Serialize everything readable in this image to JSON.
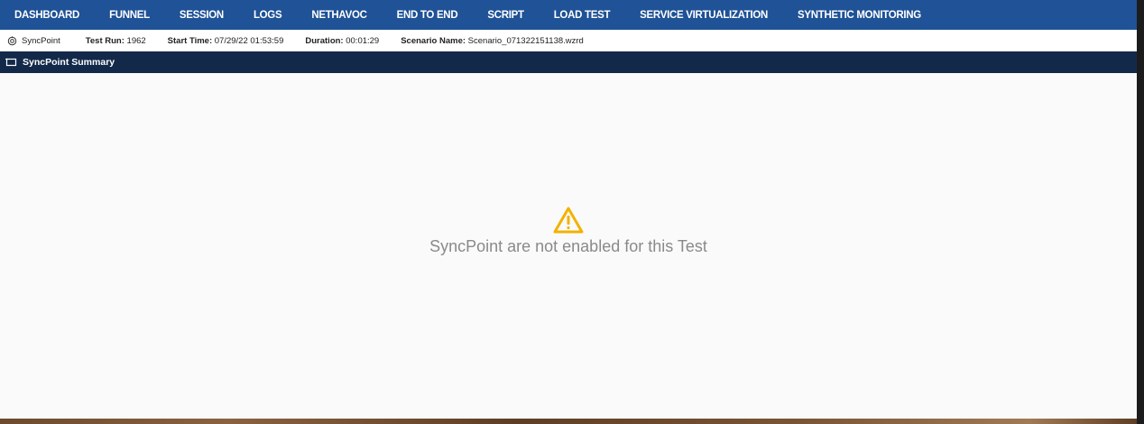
{
  "nav": {
    "items": [
      "DASHBOARD",
      "FUNNEL",
      "SESSION",
      "LOGS",
      "NETHAVOC",
      "END TO END",
      "SCRIPT",
      "LOAD TEST",
      "SERVICE VIRTUALIZATION",
      "SYNTHETIC MONITORING"
    ]
  },
  "info": {
    "section": "SyncPoint",
    "test_run_label": "Test Run:",
    "test_run": "1962",
    "start_time_label": "Start Time:",
    "start_time": "07/29/22 01:53:59",
    "duration_label": "Duration:",
    "duration": "00:01:29",
    "scenario_label": "Scenario Name:",
    "scenario": "Scenario_071322151138.wzrd"
  },
  "panel": {
    "title": "SyncPoint Summary",
    "icon": "panel-icon"
  },
  "empty": {
    "icon": "warning-icon",
    "message": "SyncPoint are not enabled for this Test"
  },
  "colors": {
    "nav_bg": "#1f5296",
    "panel_header_bg": "#13294a",
    "warning": "#f2b200",
    "message_text": "#8a8a8a"
  }
}
